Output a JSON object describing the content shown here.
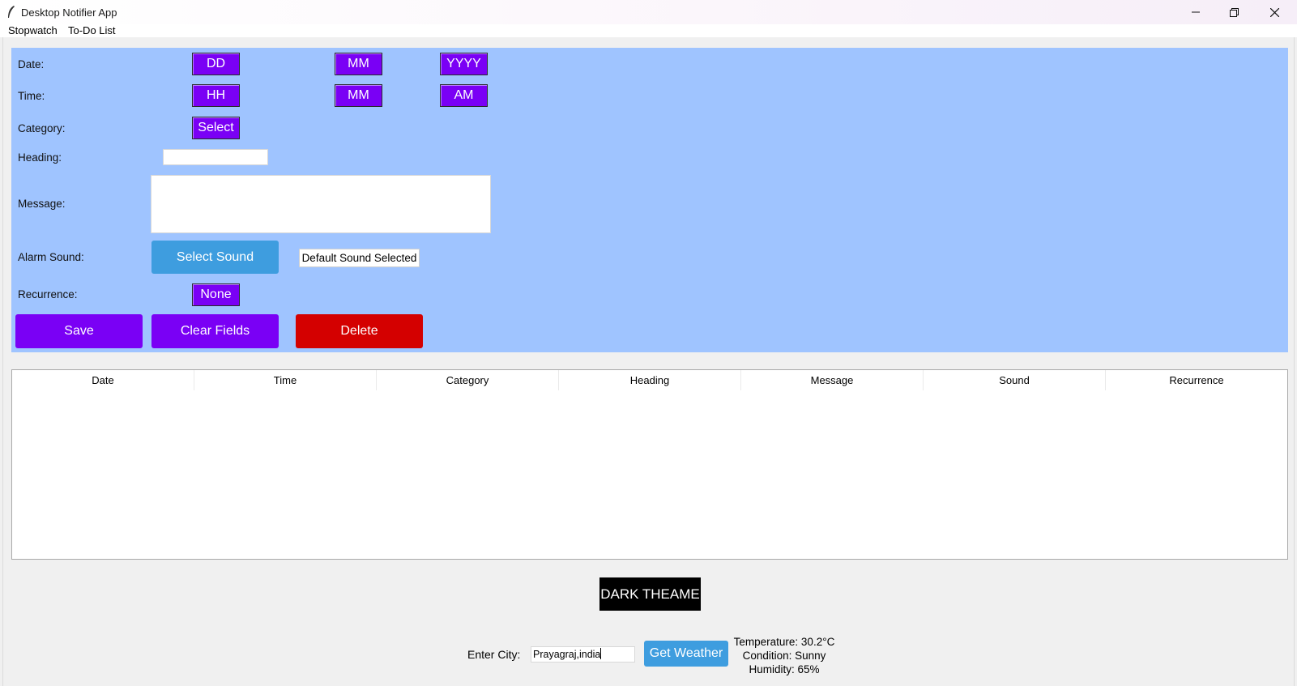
{
  "window": {
    "title": "Desktop Notifier App"
  },
  "menu": {
    "items": [
      "Stopwatch",
      "To-Do List"
    ]
  },
  "form": {
    "date_label": "Date:",
    "time_label": "Time:",
    "category_label": "Category:",
    "heading_label": "Heading:",
    "message_label": "Message:",
    "alarm_label": "Alarm Sound:",
    "recurrence_label": "Recurrence:",
    "day_value": "DD",
    "month_value": "MM",
    "year_value": "YYYY",
    "hour_value": "HH",
    "minute_value": "MM",
    "ampm_value": "AM",
    "category_value": "Select",
    "recurrence_value": "None",
    "heading_value": "",
    "message_value": "",
    "select_sound_label": "Select Sound",
    "sound_status": "Default Sound Selected",
    "save_label": "Save",
    "clear_label": "Clear Fields",
    "delete_label": "Delete"
  },
  "table": {
    "columns": [
      "Date",
      "Time",
      "Category",
      "Heading",
      "Message",
      "Sound",
      "Recurrence"
    ],
    "rows": []
  },
  "theme": {
    "toggle_label": "DARK THEAME"
  },
  "weather": {
    "city_label": "Enter City:",
    "city_value": "Prayagraj,india",
    "button_label": "Get Weather",
    "temperature": "Temperature: 30.2°C",
    "condition": "Condition: Sunny",
    "humidity": "Humidity: 65%"
  },
  "colors": {
    "panel_bg": "#9fc4ff",
    "purple_button": "#7a00f5",
    "blue_button": "#3e9ddf",
    "delete_button": "#d40000",
    "theme_button": "#000000"
  }
}
